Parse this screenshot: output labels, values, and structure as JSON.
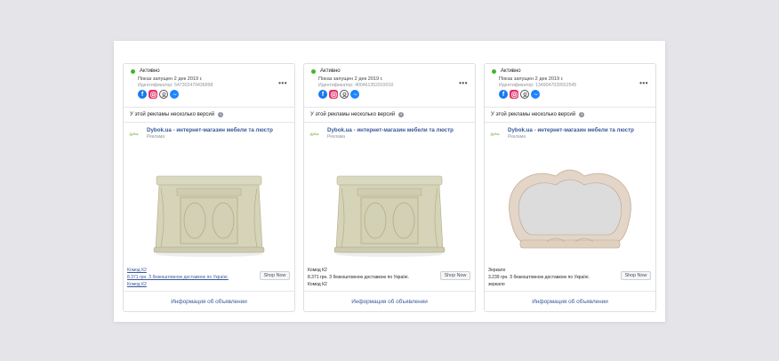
{
  "cards": [
    {
      "status": "Активно",
      "launched": "Показ запущен 2 дек 2019 г.",
      "ident": "Идентификатор: 547302479436898",
      "versions": "У этой рекламы несколько версий",
      "page_name": "Dybok.ua - интернет-магазин мебели та люстр",
      "sponsored": "Реклама",
      "logo_text": "Дубок",
      "product": "Комод К2",
      "line2": "8.371 грн. З безкоштовною доставкою по Україні.",
      "line3": "Комод К2",
      "cta": "Shop Now",
      "details_link": "Информация об объявлении",
      "image": "dresser"
    },
    {
      "status": "Активно",
      "launched": "Показ запущен 2 дек 2019 г.",
      "ident": "Идентификатор: 400461352919010",
      "versions": "У этой рекламы несколько версий",
      "page_name": "Dybok.ua - интернет-магазин мебели та люстр",
      "sponsored": "Реклама",
      "logo_text": "Дубок",
      "product": "Комод К2",
      "line2": "8.371 грн. З безкоштовною доставкою по Україні.",
      "line3": "Комод К2",
      "cta": "Shop Now",
      "details_link": "Информация об объявлении",
      "image": "dresser"
    },
    {
      "status": "Активно",
      "launched": "Показ запущен 2 дек 2019 г.",
      "ident": "Идентификатор: 1349047039552545",
      "versions": "У этой рекламы несколько версий",
      "page_name": "Dybok.ua - интернет-магазин мебели та люстр",
      "sponsored": "Реклама",
      "logo_text": "Дубок",
      "product": "Зеркало",
      "line2": "3.239 грн. З безкоштовною доставкою по Україні.",
      "line3": "зеркало",
      "cta": "Shop Now",
      "details_link": "Информация об объявлении",
      "image": "mirror"
    }
  ],
  "icons": {
    "platforms": [
      "facebook-icon",
      "instagram-icon",
      "audience-network-icon",
      "messenger-icon"
    ],
    "status_color": "#42b72a",
    "link_color": "#385898"
  }
}
